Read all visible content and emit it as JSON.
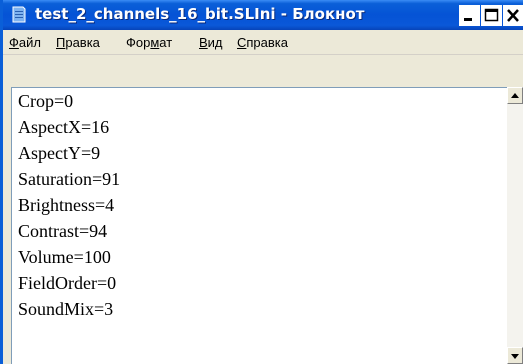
{
  "window": {
    "title": "test_2_channels_16_bit.SLIni - Блокнот",
    "controls": {
      "minimize": "minimize-icon",
      "maximize": "maximize-icon",
      "close": "close-icon"
    }
  },
  "menu": {
    "items": [
      {
        "first": "Ф",
        "rest": "айл"
      },
      {
        "first": "П",
        "rest": "равка"
      },
      {
        "pre": "Фор",
        "first": "м",
        "rest": "ат"
      },
      {
        "first": "В",
        "rest": "ид"
      },
      {
        "first": "С",
        "rest": "правка"
      }
    ]
  },
  "editor": {
    "lines": [
      "Crop=0",
      "AspectX=16",
      "AspectY=9",
      "Saturation=91",
      "Brightness=4",
      "Contrast=94",
      "Volume=100",
      "FieldOrder=0",
      "SoundMix=3"
    ]
  },
  "colors": {
    "titlebar": "#0553d6",
    "window_bg": "#ece9d8",
    "editor_bg": "#ffffff"
  }
}
